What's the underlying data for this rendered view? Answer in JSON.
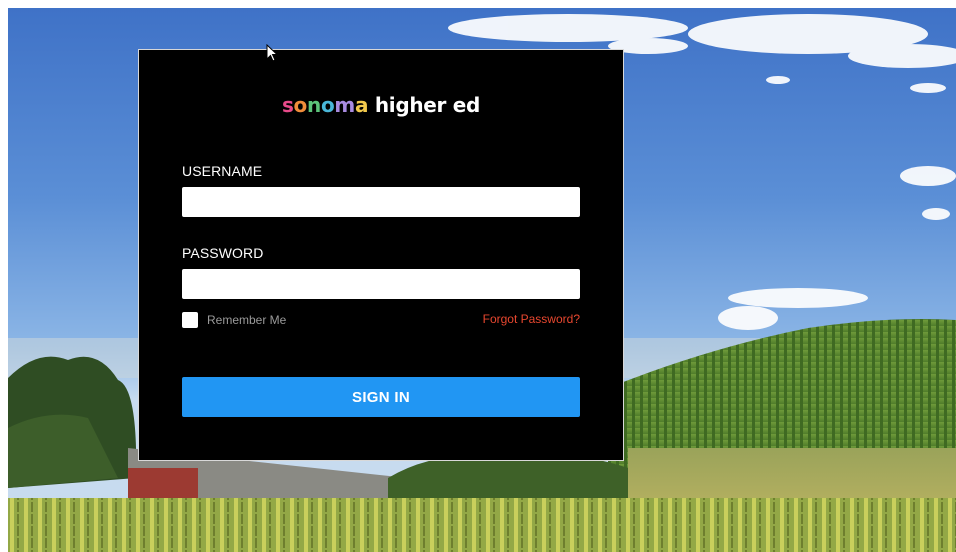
{
  "logo": {
    "s": "s",
    "o1": "o",
    "n": "n",
    "o2": "o",
    "m": "m",
    "a": "a",
    "rest": " higher ed"
  },
  "form": {
    "username_label": "USERNAME",
    "username_value": "",
    "password_label": "PASSWORD",
    "password_value": "",
    "remember_label": "Remember Me",
    "remember_checked": false,
    "forgot_label": "Forgot Password?",
    "signin_label": "SIGN IN"
  },
  "colors": {
    "card_bg": "#000000",
    "accent_button": "#2196f3",
    "forgot_link": "#e8472f"
  },
  "icons": {
    "cursor": "mouse-pointer-icon"
  }
}
